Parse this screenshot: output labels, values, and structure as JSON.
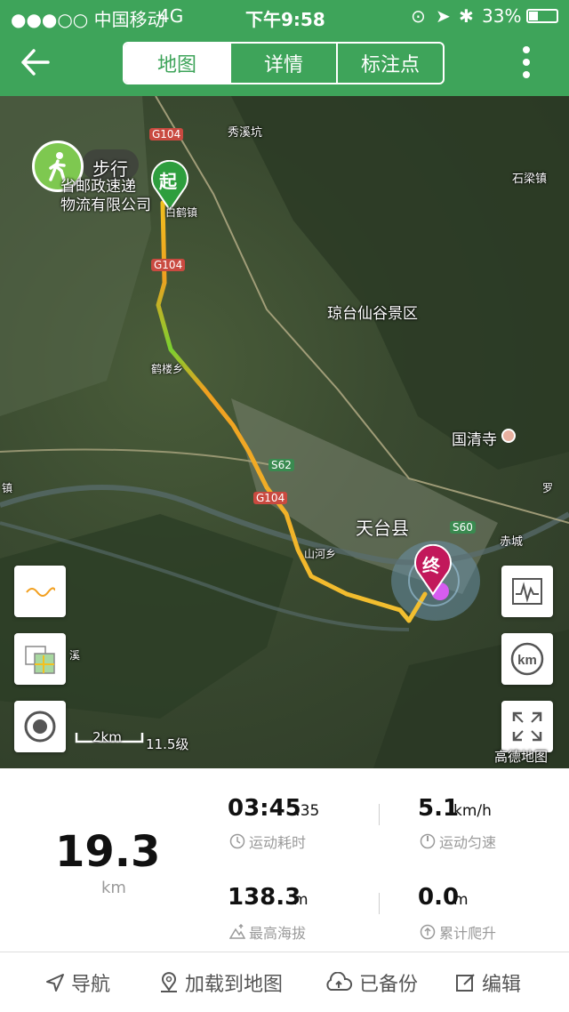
{
  "status_bar": {
    "carrier": "●●●○○ 中国移动",
    "network": "4G",
    "time": "下午9:58",
    "battery": "33%"
  },
  "nav": {
    "tabs": [
      "地图",
      "详情",
      "标注点"
    ],
    "active_tab": "地图"
  },
  "map": {
    "mode_label": "步行",
    "start_marker": "起",
    "end_marker": "终",
    "labels": {
      "company": "省邮政速递\n物流有限公司",
      "xiuxikeng": "秀溪坑",
      "shiliangzhen": "石梁镇",
      "qiongtai": "琼台仙谷景区",
      "guoqingsi": "国清寺",
      "tiantai": "天台县",
      "shanhe": "山河乡",
      "chicheng": "赤城",
      "jiangling": "鹤楼乡",
      "baihe": "白鹤镇",
      "zhen_left": "镇",
      "xi_left": "溪",
      "luo_right": "罗"
    },
    "road_badges": [
      "G104",
      "G104",
      "G104",
      "S62",
      "S60"
    ],
    "scale": {
      "distance": "2km",
      "zoom": "11.5级"
    },
    "provider": "高德地图"
  },
  "stats": {
    "distance": {
      "value": "19.3",
      "unit": "km"
    },
    "duration": {
      "value": "03:45",
      "seconds": ":35",
      "label": "运动耗时"
    },
    "pace": {
      "value": "5.1",
      "unit": "km/h",
      "label": "运动匀速"
    },
    "altitude": {
      "value": "138.3",
      "unit": "m",
      "label": "最高海拔"
    },
    "climb": {
      "value": "0.0",
      "unit": "m",
      "label": "累计爬升"
    }
  },
  "bottom_bar": {
    "navigate": "导航",
    "load_to_map": "加载到地图",
    "backed_up": "已备份",
    "edit": "编辑"
  },
  "colors": {
    "brand_green": "#3ea45a",
    "start_green": "#2e9e3e",
    "end_magenta": "#c2185b"
  }
}
